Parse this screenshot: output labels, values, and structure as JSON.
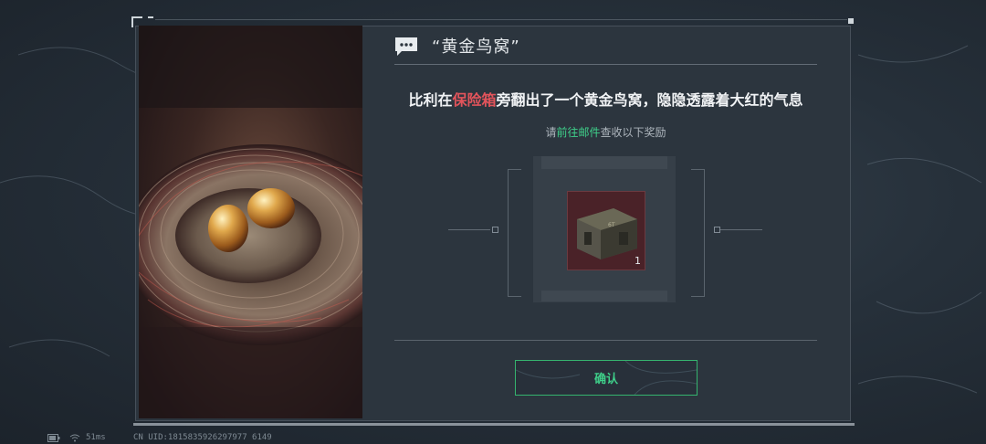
{
  "dialog": {
    "title": "“黄金鸟窝”",
    "headline": {
      "prefix": "比利在",
      "highlight": "保险箱",
      "suffix": "旁翻出了一个黄金鸟窝，隐隐透露着大红的气息"
    },
    "sub": {
      "prefix": "请",
      "highlight": "前往邮件",
      "suffix": "查收以下奖励"
    },
    "reward": {
      "count": "1",
      "icon": "crate-icon"
    },
    "confirm_label": "确认"
  },
  "status": {
    "ping": "51ms",
    "uid": "CN UID:1815835926297977 6149"
  },
  "colors": {
    "highlight_red": "#e2545b",
    "highlight_green": "#3fd08a",
    "background": "#26303a"
  }
}
